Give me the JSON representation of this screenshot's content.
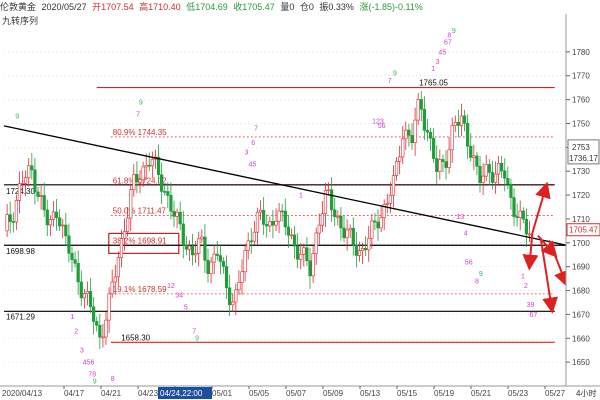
{
  "header": {
    "instrument": "伦敦黄金",
    "date": "2020/05/27",
    "open": "开1707.54",
    "high": "高1710.40",
    "low": "低1704.69",
    "close": "收1705.47",
    "volume": "量0",
    "position": "仓0",
    "amplitude": "振0.33%",
    "change": "涨(-1.85)-0.11%",
    "indicator": "九转序列"
  },
  "footer": {
    "start_date": "2020/04/13",
    "cursor_date": "04/24,22:00",
    "period": "4小时"
  },
  "colors": {
    "up": "#e0282e",
    "down": "#1f9d3a",
    "seq": "#cc44cc",
    "seq_green": "#33bb55",
    "arrow": "#e02020",
    "grid": "#cccccc"
  },
  "chart_data": {
    "type": "candlestick",
    "title": "",
    "ylim": [
      1640,
      1790
    ],
    "y_ticks": [
      1650,
      1660,
      1670,
      1680,
      1690,
      1700,
      1710,
      1720,
      1730,
      1740,
      1750,
      1760,
      1770,
      1780
    ],
    "x_ticks": [
      "04/17",
      "04/21",
      "04/23",
      "04/29",
      "05/01",
      "05/05",
      "05/07",
      "05/09",
      "05/13",
      "05/15",
      "05/19",
      "05/21",
      "05/23",
      "05/27"
    ],
    "price_box": [
      "2753",
      "1736.17"
    ],
    "current_price": "1705.47",
    "levels": [
      {
        "label": "1765.05",
        "value": 1765.05,
        "style": "solid-red"
      },
      {
        "label": "80.9% 1744.35",
        "value": 1744.35,
        "style": "dotted"
      },
      {
        "label": "1724.30",
        "value": 1724.3,
        "style": "solid-black"
      },
      {
        "label": "61.8% 1724.02",
        "value": 1724.02,
        "style": "dotted"
      },
      {
        "label": "50.0% 1711.47",
        "value": 1711.47,
        "style": "dotted"
      },
      {
        "label": "38.2% 1698.91",
        "value": 1698.91,
        "style": "dotted-boxed"
      },
      {
        "label": "1698.98",
        "value": 1698.98,
        "style": "solid-black"
      },
      {
        "label": "19.1% 1678.59",
        "value": 1678.59,
        "style": "dotted"
      },
      {
        "label": "1671.29",
        "value": 1671.29,
        "style": "solid-black"
      },
      {
        "label": "1658.30",
        "value": 1658.3,
        "style": "solid-red"
      }
    ],
    "trendline": {
      "from": [
        0.0,
        1749
      ],
      "to": [
        1.0,
        1699
      ]
    },
    "close_path": [
      [
        0.0,
        1705
      ],
      [
        0.015,
        1712
      ],
      [
        0.03,
        1725
      ],
      [
        0.05,
        1730
      ],
      [
        0.065,
        1718
      ],
      [
        0.08,
        1706
      ],
      [
        0.095,
        1715
      ],
      [
        0.11,
        1700
      ],
      [
        0.125,
        1690
      ],
      [
        0.14,
        1680
      ],
      [
        0.155,
        1672
      ],
      [
        0.17,
        1660
      ],
      [
        0.185,
        1672
      ],
      [
        0.2,
        1690
      ],
      [
        0.215,
        1708
      ],
      [
        0.23,
        1724
      ],
      [
        0.245,
        1730
      ],
      [
        0.26,
        1736
      ],
      [
        0.275,
        1728
      ],
      [
        0.29,
        1720
      ],
      [
        0.305,
        1710
      ],
      [
        0.32,
        1702
      ],
      [
        0.335,
        1695
      ],
      [
        0.35,
        1700
      ],
      [
        0.365,
        1690
      ],
      [
        0.38,
        1696
      ],
      [
        0.395,
        1682
      ],
      [
        0.41,
        1675
      ],
      [
        0.425,
        1690
      ],
      [
        0.44,
        1705
      ],
      [
        0.455,
        1712
      ],
      [
        0.47,
        1705
      ],
      [
        0.485,
        1714
      ],
      [
        0.5,
        1707
      ],
      [
        0.515,
        1700
      ],
      [
        0.53,
        1695
      ],
      [
        0.545,
        1688
      ],
      [
        0.56,
        1710
      ],
      [
        0.575,
        1720
      ],
      [
        0.59,
        1712
      ],
      [
        0.605,
        1705
      ],
      [
        0.62,
        1700
      ],
      [
        0.635,
        1696
      ],
      [
        0.65,
        1702
      ],
      [
        0.665,
        1710
      ],
      [
        0.68,
        1716
      ],
      [
        0.695,
        1726
      ],
      [
        0.71,
        1748
      ],
      [
        0.725,
        1742
      ],
      [
        0.74,
        1760
      ],
      [
        0.755,
        1745
      ],
      [
        0.77,
        1730
      ],
      [
        0.785,
        1735
      ],
      [
        0.8,
        1748
      ],
      [
        0.815,
        1752
      ],
      [
        0.83,
        1740
      ],
      [
        0.845,
        1725
      ],
      [
        0.86,
        1732
      ],
      [
        0.875,
        1728
      ],
      [
        0.89,
        1730
      ],
      [
        0.905,
        1716
      ],
      [
        0.92,
        1708
      ],
      [
        0.935,
        1705
      ]
    ],
    "arrows": [
      {
        "from": [
          0.94,
          1704
        ],
        "to": [
          0.965,
          1724
        ]
      },
      {
        "from": [
          0.94,
          1704
        ],
        "to": [
          0.935,
          1690
        ]
      },
      {
        "from": [
          0.95,
          1703
        ],
        "to": [
          0.98,
          1695
        ]
      },
      {
        "from": [
          0.955,
          1702
        ],
        "to": [
          0.975,
          1672
        ]
      },
      {
        "from": [
          0.97,
          1701
        ],
        "to": [
          1.0,
          1683
        ]
      }
    ],
    "seq_labels": [
      {
        "t": "9",
        "x": 0.02,
        "y": 1752,
        "c": "green"
      },
      {
        "t": "1",
        "x": 0.118,
        "y": 1668,
        "c": "pink"
      },
      {
        "t": "2",
        "x": 0.125,
        "y": 1662,
        "c": "pink"
      },
      {
        "t": "3",
        "x": 0.135,
        "y": 1654,
        "c": "pink"
      },
      {
        "t": "456",
        "x": 0.14,
        "y": 1649,
        "c": "pink"
      },
      {
        "t": "78",
        "x": 0.15,
        "y": 1644,
        "c": "pink"
      },
      {
        "t": "9",
        "x": 0.158,
        "y": 1641,
        "c": "green"
      },
      {
        "t": "8",
        "x": 0.19,
        "y": 1642,
        "c": "pink"
      },
      {
        "t": "9",
        "x": 0.24,
        "y": 1758,
        "c": "green"
      },
      {
        "t": "7",
        "x": 0.235,
        "y": 1753,
        "c": "pink"
      },
      {
        "t": "12",
        "x": 0.29,
        "y": 1681,
        "c": "pink"
      },
      {
        "t": "34",
        "x": 0.305,
        "y": 1677,
        "c": "pink"
      },
      {
        "t": "5",
        "x": 0.32,
        "y": 1672,
        "c": "pink"
      },
      {
        "t": "7",
        "x": 0.335,
        "y": 1662,
        "c": "pink"
      },
      {
        "t": "9",
        "x": 0.34,
        "y": 1659,
        "c": "green"
      },
      {
        "t": "7",
        "x": 0.445,
        "y": 1747,
        "c": "pink"
      },
      {
        "t": "6",
        "x": 0.44,
        "y": 1741,
        "c": "pink"
      },
      {
        "t": "3",
        "x": 0.428,
        "y": 1737,
        "c": "pink"
      },
      {
        "t": "45",
        "x": 0.435,
        "y": 1732,
        "c": "pink"
      },
      {
        "t": "1",
        "x": 0.525,
        "y": 1719,
        "c": "pink"
      },
      {
        "t": "9",
        "x": 0.692,
        "y": 1770,
        "c": "green"
      },
      {
        "t": "7",
        "x": 0.683,
        "y": 1767,
        "c": "pink"
      },
      {
        "t": "123",
        "x": 0.655,
        "y": 1750,
        "c": "pink"
      },
      {
        "t": "56",
        "x": 0.665,
        "y": 1748,
        "c": "pink"
      },
      {
        "t": "1",
        "x": 0.76,
        "y": 1772,
        "c": "pink"
      },
      {
        "t": "3",
        "x": 0.768,
        "y": 1775,
        "c": "pink"
      },
      {
        "t": "45",
        "x": 0.773,
        "y": 1779,
        "c": "pink"
      },
      {
        "t": "67",
        "x": 0.783,
        "y": 1783,
        "c": "pink"
      },
      {
        "t": "8",
        "x": 0.789,
        "y": 1786,
        "c": "pink"
      },
      {
        "t": "9",
        "x": 0.797,
        "y": 1788,
        "c": "green"
      },
      {
        "t": "13",
        "x": 0.805,
        "y": 1710,
        "c": "pink"
      },
      {
        "t": "4",
        "x": 0.818,
        "y": 1703,
        "c": "pink"
      },
      {
        "t": "56",
        "x": 0.82,
        "y": 1691,
        "c": "pink"
      },
      {
        "t": "8",
        "x": 0.838,
        "y": 1683,
        "c": "pink"
      },
      {
        "t": "9",
        "x": 0.845,
        "y": 1686,
        "c": "green"
      },
      {
        "t": "1",
        "x": 0.92,
        "y": 1685,
        "c": "pink"
      },
      {
        "t": "2",
        "x": 0.925,
        "y": 1681,
        "c": "pink"
      },
      {
        "t": "39",
        "x": 0.93,
        "y": 1673,
        "c": "pink"
      },
      {
        "t": "67",
        "x": 0.935,
        "y": 1669,
        "c": "pink"
      }
    ]
  }
}
